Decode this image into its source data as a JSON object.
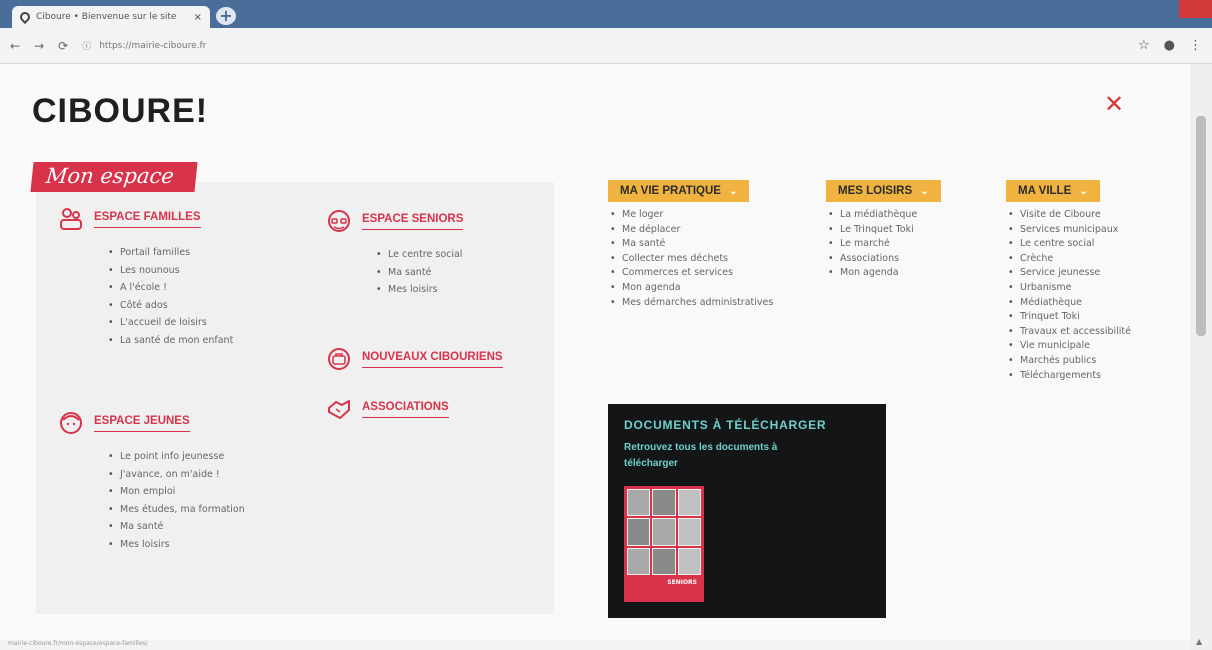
{
  "browser": {
    "tab_title": "Ciboure • Bienvenue sur le site",
    "tab_close": "×",
    "newtab": "+",
    "url": "https://mairie-ciboure.fr",
    "status_url": "mairie-ciboure.fr/mon-espace/espace-familles/"
  },
  "page": {
    "logo": "CIBOURE!",
    "close": "✕"
  },
  "espace": {
    "title": "Mon espace",
    "familles": {
      "label": "ESPACE FAMILLES",
      "items": [
        "Portail familles",
        "Les nounous",
        "A l'école !",
        "Côté ados",
        "L'accueil de loisirs",
        "La santé de mon enfant"
      ]
    },
    "jeunes": {
      "label": "ESPACE JEUNES",
      "items": [
        "Le point info jeunesse",
        "J'avance, on m'aide !",
        "Mon emploi",
        "Mes études, ma formation",
        "Ma santé",
        "Mes loisirs"
      ]
    },
    "seniors": {
      "label": "ESPACE SENIORS",
      "items": [
        "Le centre social",
        "Ma santé",
        "Mes loisirs"
      ]
    },
    "nouveaux": {
      "label": "NOUVEAUX CIBOURIENS"
    },
    "associations": {
      "label": "ASSOCIATIONS"
    }
  },
  "menus": {
    "pratique": {
      "label": "MA VIE PRATIQUE",
      "items": [
        "Me loger",
        "Me déplacer",
        "Ma santé",
        "Collecter mes déchets",
        "Commerces et services",
        "Mon agenda",
        "Mes démarches administratives"
      ]
    },
    "loisirs": {
      "label": "MES LOISIRS",
      "items": [
        "La médiathèque",
        "Le Trinquet Toki",
        "Le marché",
        "Associations",
        "Mon agenda"
      ]
    },
    "ville": {
      "label": "MA VILLE",
      "items": [
        "Visite de Ciboure",
        "Services municipaux",
        "Le centre social",
        "Crèche",
        "Service jeunesse",
        "Urbanisme",
        "Médiathèque",
        "Trinquet Toki",
        "Travaux et accessibilité",
        "Vie municipale",
        "Marchés publics",
        "Téléchargements"
      ]
    },
    "chevron": "⌄"
  },
  "docs": {
    "title": "DOCUMENTS À TÉLÉCHARGER",
    "subtitle": "Retrouvez tous les documents à télécharger",
    "cover_label": "SENIORS"
  },
  "colors": {
    "brand_red": "#d8334a",
    "menu_yellow": "#f0b33f",
    "docs_teal": "#6fd0cd"
  },
  "icons": [
    "family-icon",
    "senior-icon",
    "youth-icon",
    "newcomers-icon",
    "associations-icon"
  ]
}
